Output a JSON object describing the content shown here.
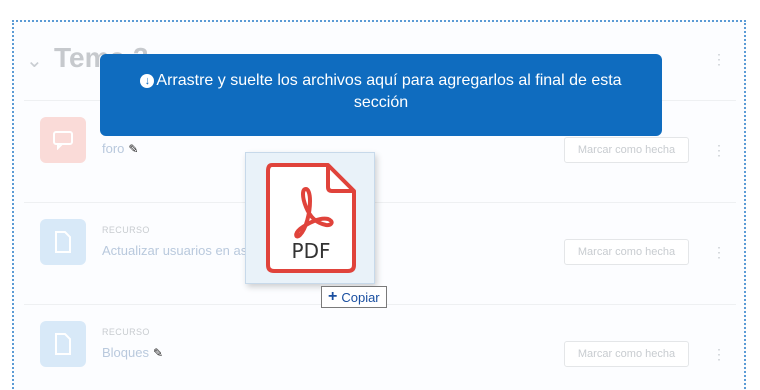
{
  "section": {
    "title": "Tema 2",
    "collapse_icon": "chevron-down-icon",
    "menu_icon": "kebab-menu-icon"
  },
  "banner": {
    "icon": "download-circle-icon",
    "message": "Arrastre y suelte los archivos aquí para agregarlos al final de esta sección"
  },
  "activities": [
    {
      "type": "",
      "name": "foro",
      "icon": "forum-icon",
      "icon_color": "#fadbd8",
      "edit_icon": "pencil-icon",
      "complete_label": "Marcar como hecha"
    },
    {
      "type": "RECURSO",
      "name": "Actualizar usuarios en asig",
      "icon": "file-icon",
      "icon_color": "#d8e9f8",
      "complete_label": "Marcar como hecha"
    },
    {
      "type": "RECURSO",
      "name": "Bloques",
      "icon": "file-icon",
      "icon_color": "#d8e9f8",
      "edit_icon": "pencil-icon",
      "complete_label": "Marcar como hecha"
    }
  ],
  "drag_ghost": {
    "file_icon": "pdf-file-icon",
    "label": "PDF"
  },
  "copy_tooltip": {
    "icon": "plus-icon",
    "label": "Copiar"
  },
  "colors": {
    "banner": "#0f6cbf",
    "pdf_red": "#e0433b",
    "drop_border": "#5b9bd5"
  }
}
